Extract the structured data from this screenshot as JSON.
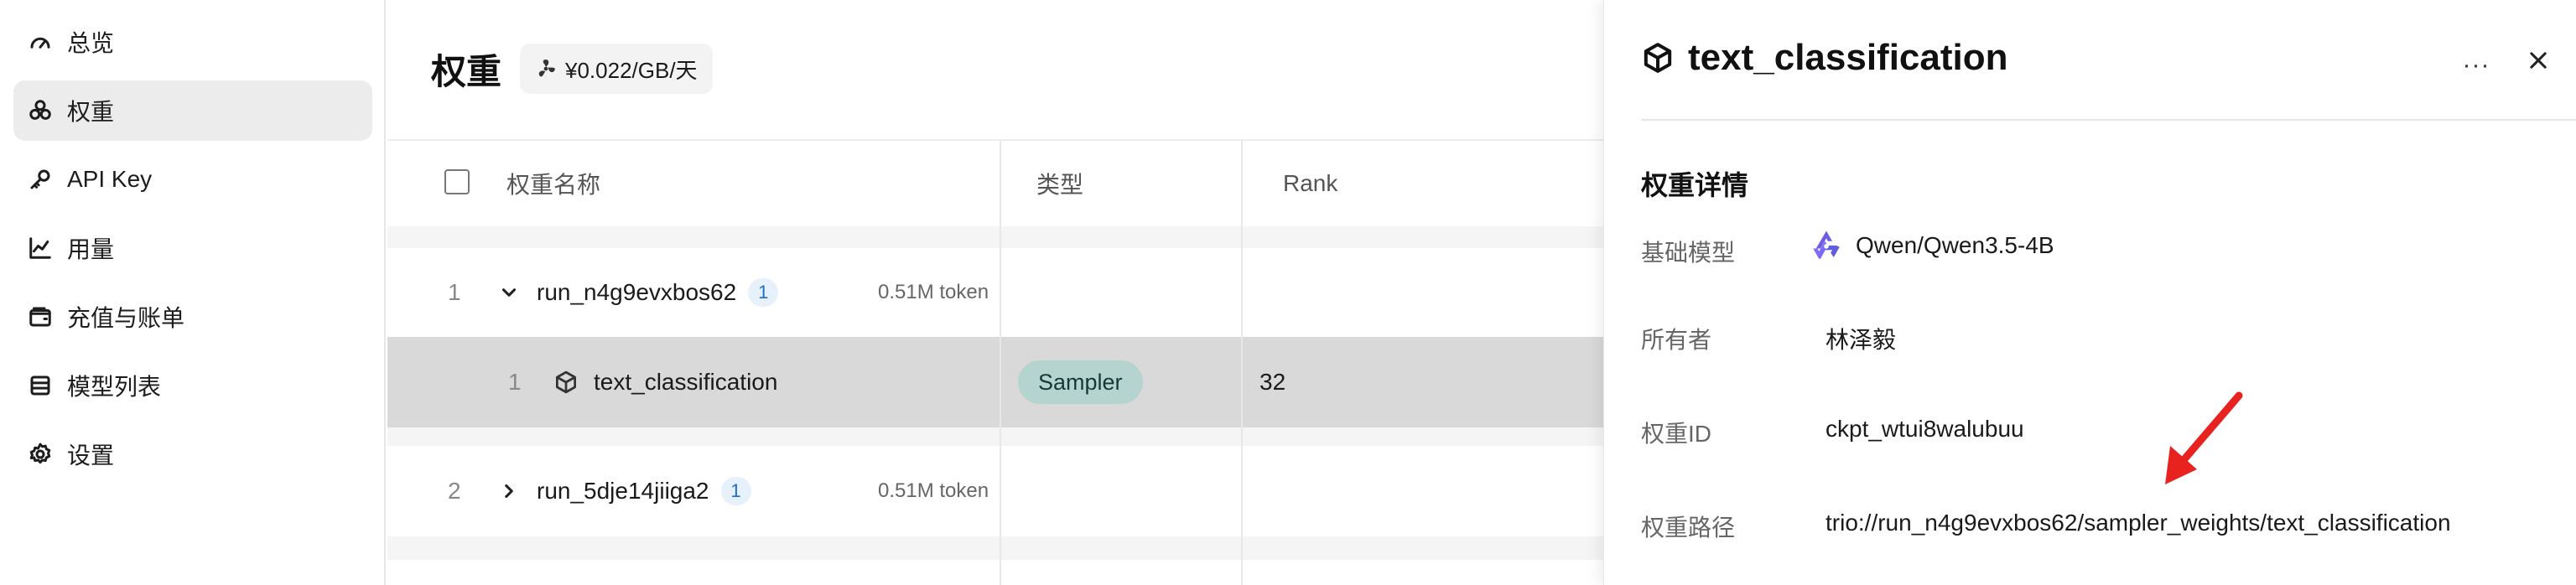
{
  "sidebar": {
    "items": [
      {
        "label": "总览",
        "icon": "gauge-icon"
      },
      {
        "label": "权重",
        "icon": "weights-icon",
        "active": true
      },
      {
        "label": "API Key",
        "icon": "key-icon"
      },
      {
        "label": "用量",
        "icon": "line-chart-icon"
      },
      {
        "label": "充值与账单",
        "icon": "wallet-icon"
      },
      {
        "label": "模型列表",
        "icon": "list-icon"
      },
      {
        "label": "设置",
        "icon": "gear-icon"
      }
    ]
  },
  "main": {
    "title": "权重",
    "price_badge": "¥0.022/GB/天",
    "table": {
      "columns": [
        "权重名称",
        "类型",
        "Rank"
      ],
      "rows": [
        {
          "index": "1",
          "name": "run_n4g9evxbos62",
          "count": "1",
          "tokens": "0.51M token",
          "expanded": true
        },
        {
          "index": "1",
          "name": "text_classification",
          "type": "Sampler",
          "rank": "32",
          "selected": true
        },
        {
          "index": "2",
          "name": "run_5dje14jiiga2",
          "count": "1",
          "tokens": "0.51M token",
          "expanded": false
        }
      ]
    }
  },
  "drawer": {
    "title": "text_classification",
    "more_label": "···",
    "section_title": "权重详情",
    "fields": [
      {
        "label": "基础模型",
        "value": "Qwen/Qwen3.5-4B"
      },
      {
        "label": "所有者",
        "value": "林泽毅"
      },
      {
        "label": "权重ID",
        "value": "ckpt_wtui8walubuu"
      },
      {
        "label": "权重路径",
        "value": "trio://run_n4g9evxbos62/sampler_weights/text_classification"
      }
    ]
  },
  "colors": {
    "accent_badge": "#1d6fc4",
    "type_pill": "#b5d3cf",
    "selected_row": "#d9d9d9",
    "annotation_arrow": "#e8231f"
  }
}
